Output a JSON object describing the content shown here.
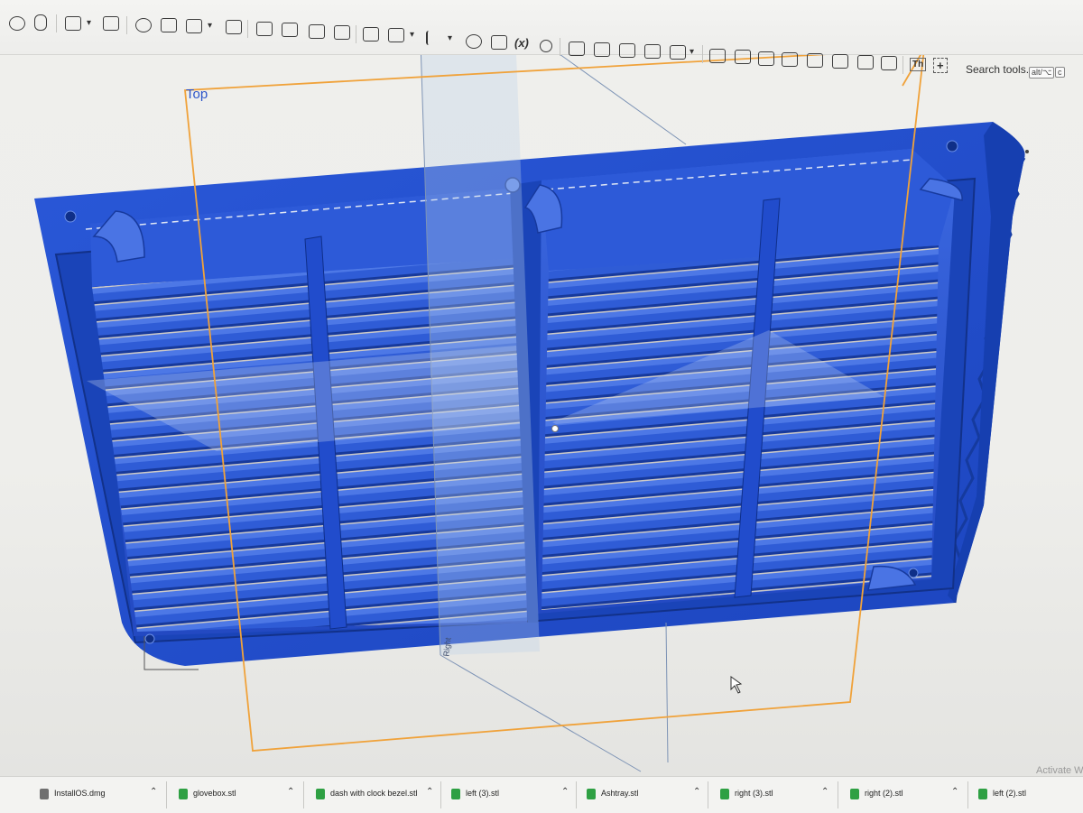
{
  "toolbar": {
    "search_label": "Search tools...",
    "shortcut_modifier": "alt/⌥",
    "shortcut_key": "c",
    "variable_icon_text": "(x)",
    "thread_icon_text": "Th"
  },
  "viewport": {
    "view_cube_label": "Top",
    "plane_label": "Right"
  },
  "watermark": "Activate W",
  "downloads": [
    {
      "name": "InstallOS.dmg",
      "icon": "disk-image-icon"
    },
    {
      "name": "glovebox.stl",
      "icon": "stl-file-icon"
    },
    {
      "name": "dash with clock bezel.stl",
      "icon": "stl-file-icon"
    },
    {
      "name": "left (3).stl",
      "icon": "stl-file-icon"
    },
    {
      "name": "Ashtray.stl",
      "icon": "stl-file-icon"
    },
    {
      "name": "right (3).stl",
      "icon": "stl-file-icon"
    },
    {
      "name": "right (2).stl",
      "icon": "stl-file-icon"
    },
    {
      "name": "left (2).stl",
      "icon": "stl-file-icon"
    }
  ],
  "colors": {
    "part": "#1f4fd0",
    "part_dark": "#153a9e",
    "sketch_plane": "#f0a23a",
    "view_label": "#2d55c9",
    "stl_icon": "#2ea043"
  }
}
